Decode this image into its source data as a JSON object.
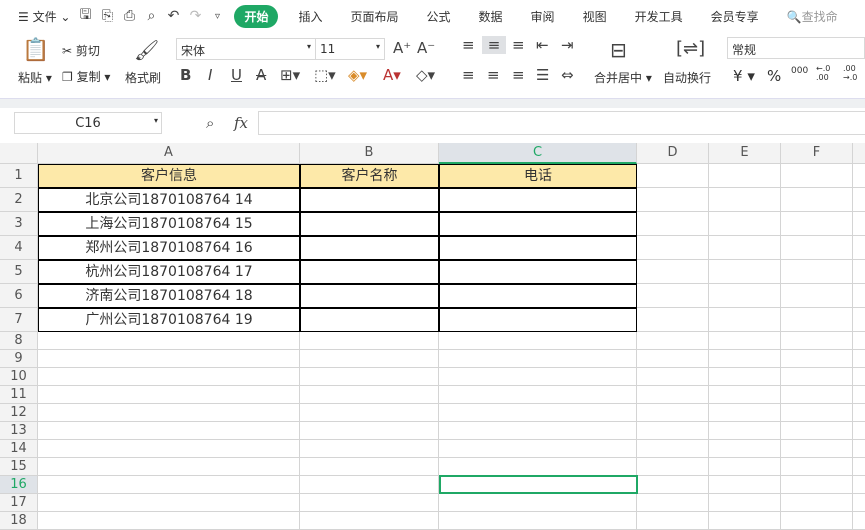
{
  "menu": {
    "file": "文件",
    "tabs": [
      "开始",
      "插入",
      "页面布局",
      "公式",
      "数据",
      "审阅",
      "视图",
      "开发工具",
      "会员专享"
    ],
    "search": "查找命"
  },
  "ribbon": {
    "paste": "粘贴",
    "cut": "剪切",
    "copy": "复制",
    "format_painter": "格式刷",
    "font": "宋体",
    "size": "11",
    "merge": "合并居中",
    "wrap": "自动换行",
    "number_format": "常规",
    "currency": "¥",
    "percent": "%",
    "thousands": "000",
    "inc_dec": "←.0 .00",
    "dec_dec": ".00 →.0"
  },
  "formula": {
    "cell_ref": "C16",
    "fx": "fx",
    "value": ""
  },
  "sheet": {
    "columns": [
      "A",
      "B",
      "C",
      "D",
      "E",
      "F"
    ],
    "rows": [
      "1",
      "2",
      "3",
      "4",
      "5",
      "6",
      "7",
      "8",
      "9",
      "10",
      "11",
      "12",
      "13",
      "14",
      "15",
      "16",
      "17",
      "18"
    ],
    "active_cell": "C16",
    "header": [
      "客户信息",
      "客户名称",
      "电话"
    ],
    "data": [
      "北京公司1870108764 14",
      "上海公司1870108764 15",
      "郑州公司1870108764 16",
      "杭州公司1870108764 17",
      "济南公司1870108764 18",
      "广州公司1870108764 19"
    ]
  }
}
